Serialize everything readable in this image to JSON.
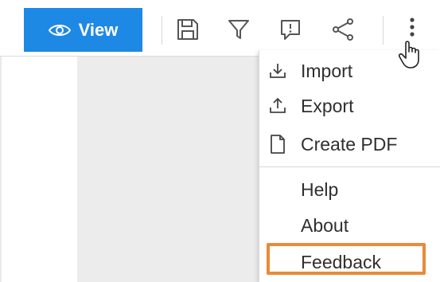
{
  "toolbar": {
    "view_label": "View",
    "icons": [
      "eye-icon",
      "save-icon",
      "filter-icon",
      "feedback-bubble-icon",
      "share-icon",
      "more-vertical-icon"
    ]
  },
  "menu": {
    "items": [
      {
        "label": "Import",
        "icon": "import-icon"
      },
      {
        "label": "Export",
        "icon": "export-icon"
      },
      {
        "label": "Create PDF",
        "icon": "document-icon"
      },
      {
        "label": "Help"
      },
      {
        "label": "About"
      },
      {
        "label": "Feedback"
      }
    ]
  },
  "colors": {
    "accent": "#1e88e5",
    "highlight": "#e88b3a",
    "background": "#ececec"
  }
}
